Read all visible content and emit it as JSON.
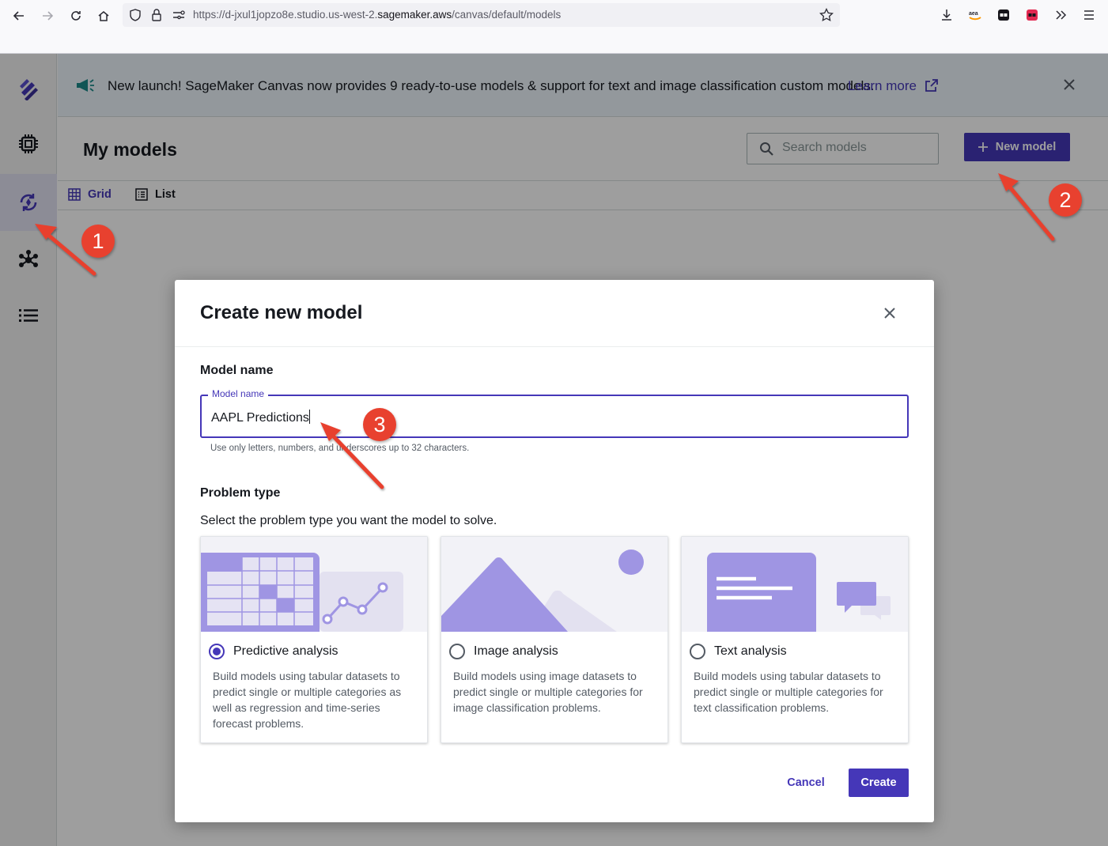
{
  "browser": {
    "url_prefix": "https://d-jxul1jopzo8e.studio.us-west-2.",
    "url_domain": "sagemaker.aws",
    "url_path": "/canvas/default/models",
    "icons": [
      "back-icon",
      "forward-icon",
      "reload-icon",
      "home-icon",
      "shield-icon",
      "lock-icon",
      "permissions-icon",
      "star-icon",
      "download-icon",
      "amazon-extension-icon",
      "extension-icon",
      "extension-red-icon",
      "overflow-icon",
      "menu-icon"
    ]
  },
  "banner": {
    "text": "New launch! SageMaker Canvas now provides 9 ready-to-use models & support for text and image classification custom models.",
    "link": "Learn more"
  },
  "page": {
    "title": "My models",
    "search_placeholder": "Search models",
    "new_model": "New model",
    "views": {
      "grid": "Grid",
      "list": "List"
    }
  },
  "modal": {
    "title": "Create new model",
    "model_name_label": "Model name",
    "input_legend": "Model name",
    "input_value": "AAPL Predictions",
    "hint": "Use only letters, numbers, and underscores up to 32 characters.",
    "problem_label": "Problem type",
    "problem_desc": "Select the problem type you want the model to solve.",
    "cards": [
      {
        "title": "Predictive analysis",
        "desc": "Build models using tabular datasets to predict single or multiple categories as well as regression and time-series forecast problems.",
        "selected": true
      },
      {
        "title": "Image analysis",
        "desc": "Build models using image datasets to predict single or multiple categories for image classification problems.",
        "selected": false
      },
      {
        "title": "Text analysis",
        "desc": "Build models using tabular datasets to predict single or multiple categories for text classification problems.",
        "selected": false
      }
    ],
    "cancel": "Cancel",
    "create": "Create"
  },
  "annotations": [
    "1",
    "2",
    "3"
  ],
  "colors": {
    "accent": "#4537b8",
    "badge": "#e8412f",
    "illustration": "#9f95e3"
  }
}
